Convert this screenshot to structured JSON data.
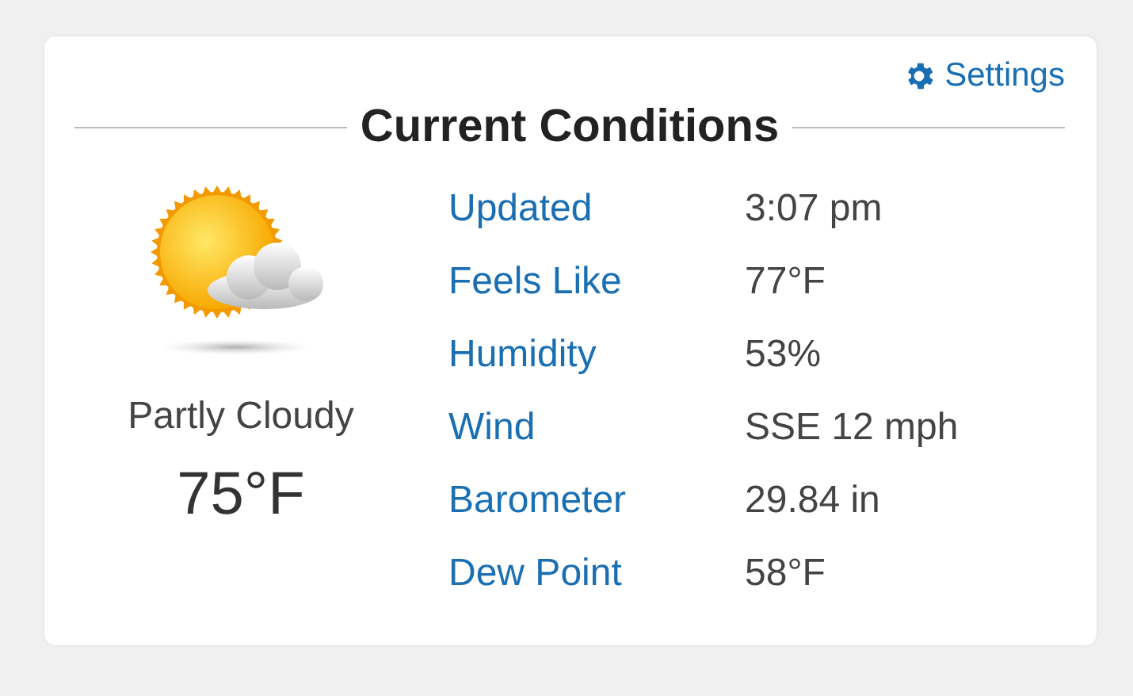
{
  "settings_link": "Settings",
  "title": "Current Conditions",
  "condition": {
    "text": "Partly Cloudy",
    "temperature": "75°F"
  },
  "details": [
    {
      "label": "Updated",
      "value": "3:07 pm"
    },
    {
      "label": "Feels Like",
      "value": "77°F"
    },
    {
      "label": "Humidity",
      "value": "53%"
    },
    {
      "label": "Wind",
      "value": "SSE 12 mph"
    },
    {
      "label": "Barometer",
      "value": "29.84 in"
    },
    {
      "label": "Dew Point",
      "value": "58°F"
    }
  ]
}
